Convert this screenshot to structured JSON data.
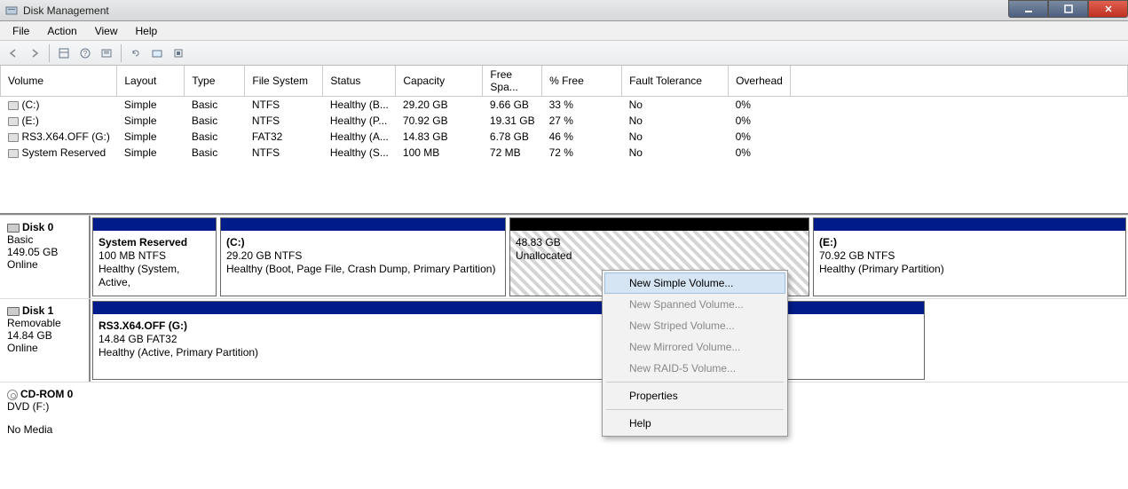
{
  "window": {
    "title": "Disk Management"
  },
  "menubar": {
    "items": [
      "File",
      "Action",
      "View",
      "Help"
    ]
  },
  "columns": [
    "Volume",
    "Layout",
    "Type",
    "File System",
    "Status",
    "Capacity",
    "Free Spa...",
    "% Free",
    "Fault Tolerance",
    "Overhead"
  ],
  "volumes": [
    {
      "name": "(C:)",
      "layout": "Simple",
      "type": "Basic",
      "fs": "NTFS",
      "status": "Healthy (B...",
      "capacity": "29.20 GB",
      "free": "9.66 GB",
      "pfree": "33 %",
      "ft": "No",
      "ov": "0%"
    },
    {
      "name": "(E:)",
      "layout": "Simple",
      "type": "Basic",
      "fs": "NTFS",
      "status": "Healthy (P...",
      "capacity": "70.92 GB",
      "free": "19.31 GB",
      "pfree": "27 %",
      "ft": "No",
      "ov": "0%"
    },
    {
      "name": "RS3.X64.OFF (G:)",
      "layout": "Simple",
      "type": "Basic",
      "fs": "FAT32",
      "status": "Healthy (A...",
      "capacity": "14.83 GB",
      "free": "6.78 GB",
      "pfree": "46 %",
      "ft": "No",
      "ov": "0%"
    },
    {
      "name": "System Reserved",
      "layout": "Simple",
      "type": "Basic",
      "fs": "NTFS",
      "status": "Healthy (S...",
      "capacity": "100 MB",
      "free": "72 MB",
      "pfree": "72 %",
      "ft": "No",
      "ov": "0%"
    }
  ],
  "disks": {
    "disk0": {
      "name": "Disk 0",
      "type": "Basic",
      "size": "149.05 GB",
      "status": "Online",
      "parts": [
        {
          "name": "System Reserved",
          "size": "100 MB NTFS",
          "status": "Healthy (System, Active,"
        },
        {
          "name": "(C:)",
          "size": "29.20 GB NTFS",
          "status": "Healthy (Boot, Page File, Crash Dump, Primary Partition)"
        },
        {
          "name": "",
          "size": "48.83 GB",
          "status": "Unallocated"
        },
        {
          "name": "(E:)",
          "size": "70.92 GB NTFS",
          "status": "Healthy (Primary Partition)"
        }
      ]
    },
    "disk1": {
      "name": "Disk 1",
      "type": "Removable",
      "size": "14.84 GB",
      "status": "Online",
      "parts": [
        {
          "name": "RS3.X64.OFF  (G:)",
          "size": "14.84 GB FAT32",
          "status": "Healthy (Active, Primary Partition)"
        }
      ]
    },
    "cdrom": {
      "name": "CD-ROM 0",
      "type": "DVD (F:)",
      "status": "No Media"
    }
  },
  "context_menu": {
    "items": [
      {
        "label": "New Simple Volume...",
        "enabled": true,
        "highlight": true
      },
      {
        "label": "New Spanned Volume...",
        "enabled": false
      },
      {
        "label": "New Striped Volume...",
        "enabled": false
      },
      {
        "label": "New Mirrored Volume...",
        "enabled": false
      },
      {
        "label": "New RAID-5 Volume...",
        "enabled": false
      },
      {
        "sep": true
      },
      {
        "label": "Properties",
        "enabled": true
      },
      {
        "sep": true
      },
      {
        "label": "Help",
        "enabled": true
      }
    ]
  }
}
